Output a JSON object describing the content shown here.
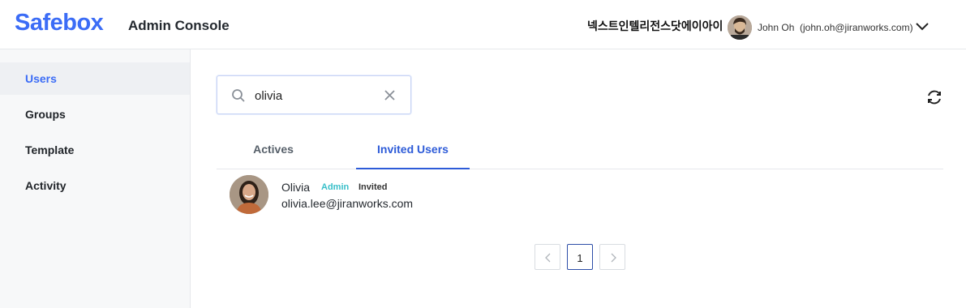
{
  "header": {
    "logo": "Safebox",
    "console_title": "Admin Console",
    "org_name": "넥스트인텔리전스닷에이아이",
    "user_name": "John Oh",
    "user_email": "(john.oh@jiranworks.com)"
  },
  "sidebar": {
    "items": [
      {
        "label": "Users",
        "active": true
      },
      {
        "label": "Groups",
        "active": false
      },
      {
        "label": "Template",
        "active": false
      },
      {
        "label": "Activity",
        "active": false
      }
    ]
  },
  "search": {
    "value": "olivia",
    "icon": "search-icon",
    "clear_icon": "close-icon"
  },
  "toolbar": {
    "refresh_icon": "refresh-icon"
  },
  "tabs": [
    {
      "label": "Actives",
      "active": false
    },
    {
      "label": "Invited Users",
      "active": true
    }
  ],
  "users": [
    {
      "name": "Olivia",
      "role": "Admin",
      "status": "Invited",
      "email": "olivia.lee@jiranworks.com"
    }
  ],
  "pagination": {
    "current_page": "1"
  },
  "colors": {
    "brand": "#3b6cf6",
    "active_tab": "#2d5bd8",
    "role_badge": "#38bfc9"
  }
}
